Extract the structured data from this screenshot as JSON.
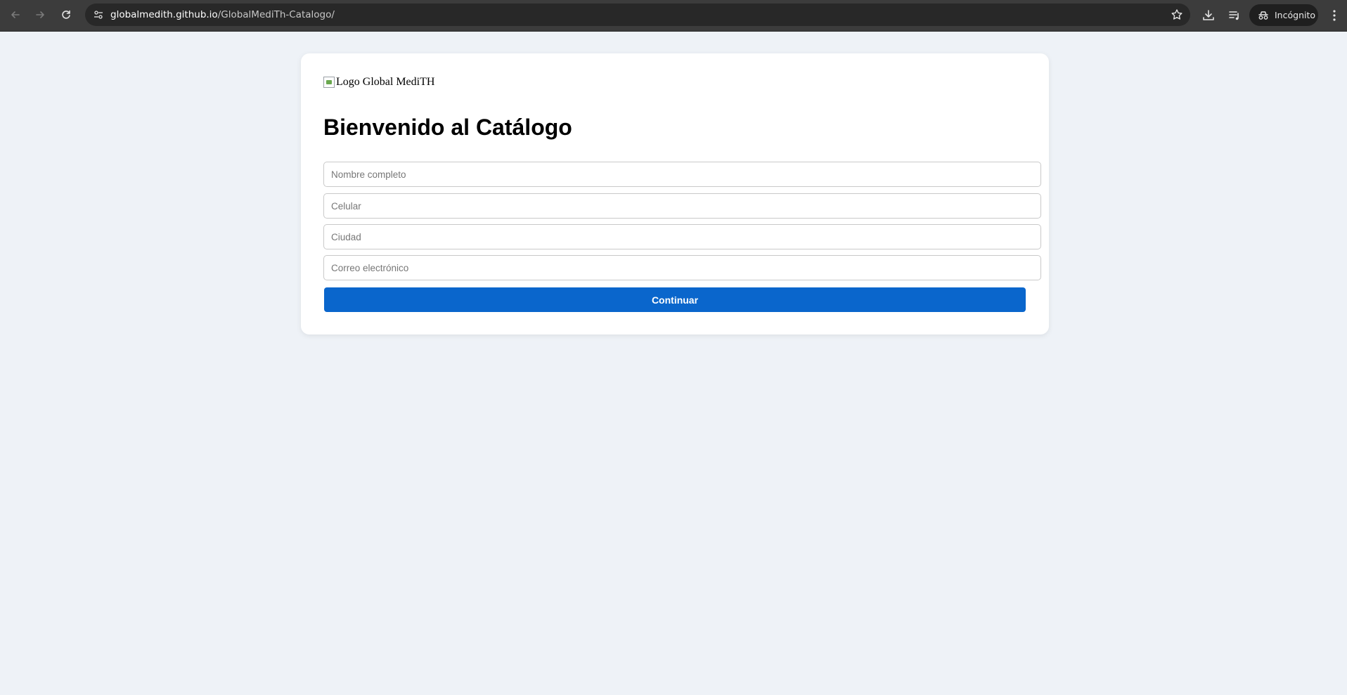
{
  "browser": {
    "url_host": "globalmedith.github.io",
    "url_path": "/GlobalMediTh-Catalogo/",
    "incognito_label": "Incógnito",
    "icons": {
      "back": "back-arrow-icon",
      "forward": "forward-arrow-icon",
      "reload": "reload-icon",
      "site_info": "tune-icon",
      "bookmark": "star-icon",
      "download": "download-icon",
      "media": "media-controls-icon",
      "incognito": "incognito-icon",
      "menu": "kebab-menu-icon"
    }
  },
  "page": {
    "logo_alt": "Logo Global MediTH",
    "title": "Bienvenido al Catálogo",
    "form": {
      "name_placeholder": "Nombre completo",
      "phone_placeholder": "Celular",
      "city_placeholder": "Ciudad",
      "email_placeholder": "Correo electrónico",
      "submit_label": "Continuar"
    }
  },
  "colors": {
    "page_background": "#eef2f7",
    "button": "#0a66cc",
    "chrome": "#3c3c3c"
  }
}
